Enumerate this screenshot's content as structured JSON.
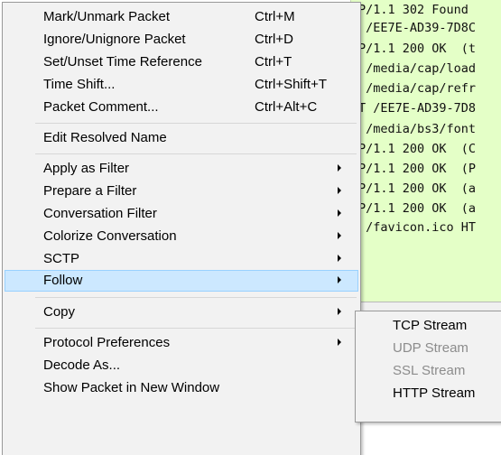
{
  "packet_list": {
    "lines": [
      "P/1.1 302 Found",
      " /EE7E-AD39-7D8C",
      "P/1.1 200 OK  (t",
      " /media/cap/load",
      " /media/cap/refr",
      "T /EE7E-AD39-7D8",
      " /media/bs3/font",
      "P/1.1 200 OK  (C",
      "P/1.1 200 OK  (P",
      "P/1.1 200 OK  (a",
      "P/1.1 200 OK  (a",
      " /favicon.ico HT"
    ]
  },
  "context_menu": {
    "items": [
      {
        "label": "Mark/Unmark Packet",
        "shortcut": "Ctrl+M"
      },
      {
        "label": "Ignore/Unignore Packet",
        "shortcut": "Ctrl+D"
      },
      {
        "label": "Set/Unset Time Reference",
        "shortcut": "Ctrl+T"
      },
      {
        "label": "Time Shift...",
        "shortcut": "Ctrl+Shift+T"
      },
      {
        "label": "Packet Comment...",
        "shortcut": "Ctrl+Alt+C"
      },
      {
        "label": "Edit Resolved Name"
      },
      {
        "label": "Apply as Filter"
      },
      {
        "label": "Prepare a Filter"
      },
      {
        "label": "Conversation Filter"
      },
      {
        "label": "Colorize Conversation"
      },
      {
        "label": "SCTP"
      },
      {
        "label": "Follow"
      },
      {
        "label": "Copy"
      },
      {
        "label": "Protocol Preferences"
      },
      {
        "label": "Decode As..."
      },
      {
        "label": "Show Packet in New Window"
      }
    ]
  },
  "follow_submenu": {
    "items": [
      {
        "label": "TCP Stream",
        "enabled": true
      },
      {
        "label": "UDP Stream",
        "enabled": false
      },
      {
        "label": "SSL Stream",
        "enabled": false
      },
      {
        "label": "HTTP Stream",
        "enabled": true
      }
    ]
  },
  "colors": {
    "packet_row_bg": "#e4ffc7",
    "menu_bg": "#f2f2f2",
    "highlight_bg": "#cce8ff",
    "highlight_border": "#99d1ff",
    "disabled_text": "#8c8c8c"
  }
}
